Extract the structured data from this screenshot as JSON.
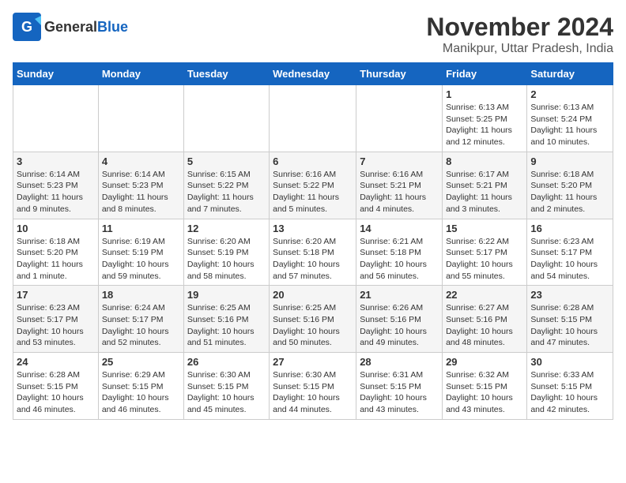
{
  "logo": {
    "general": "General",
    "blue": "Blue"
  },
  "title": "November 2024",
  "location": "Manikpur, Uttar Pradesh, India",
  "headers": [
    "Sunday",
    "Monday",
    "Tuesday",
    "Wednesday",
    "Thursday",
    "Friday",
    "Saturday"
  ],
  "rows": [
    [
      {
        "day": "",
        "info": ""
      },
      {
        "day": "",
        "info": ""
      },
      {
        "day": "",
        "info": ""
      },
      {
        "day": "",
        "info": ""
      },
      {
        "day": "",
        "info": ""
      },
      {
        "day": "1",
        "info": "Sunrise: 6:13 AM\nSunset: 5:25 PM\nDaylight: 11 hours and 12 minutes."
      },
      {
        "day": "2",
        "info": "Sunrise: 6:13 AM\nSunset: 5:24 PM\nDaylight: 11 hours and 10 minutes."
      }
    ],
    [
      {
        "day": "3",
        "info": "Sunrise: 6:14 AM\nSunset: 5:23 PM\nDaylight: 11 hours and 9 minutes."
      },
      {
        "day": "4",
        "info": "Sunrise: 6:14 AM\nSunset: 5:23 PM\nDaylight: 11 hours and 8 minutes."
      },
      {
        "day": "5",
        "info": "Sunrise: 6:15 AM\nSunset: 5:22 PM\nDaylight: 11 hours and 7 minutes."
      },
      {
        "day": "6",
        "info": "Sunrise: 6:16 AM\nSunset: 5:22 PM\nDaylight: 11 hours and 5 minutes."
      },
      {
        "day": "7",
        "info": "Sunrise: 6:16 AM\nSunset: 5:21 PM\nDaylight: 11 hours and 4 minutes."
      },
      {
        "day": "8",
        "info": "Sunrise: 6:17 AM\nSunset: 5:21 PM\nDaylight: 11 hours and 3 minutes."
      },
      {
        "day": "9",
        "info": "Sunrise: 6:18 AM\nSunset: 5:20 PM\nDaylight: 11 hours and 2 minutes."
      }
    ],
    [
      {
        "day": "10",
        "info": "Sunrise: 6:18 AM\nSunset: 5:20 PM\nDaylight: 11 hours and 1 minute."
      },
      {
        "day": "11",
        "info": "Sunrise: 6:19 AM\nSunset: 5:19 PM\nDaylight: 10 hours and 59 minutes."
      },
      {
        "day": "12",
        "info": "Sunrise: 6:20 AM\nSunset: 5:19 PM\nDaylight: 10 hours and 58 minutes."
      },
      {
        "day": "13",
        "info": "Sunrise: 6:20 AM\nSunset: 5:18 PM\nDaylight: 10 hours and 57 minutes."
      },
      {
        "day": "14",
        "info": "Sunrise: 6:21 AM\nSunset: 5:18 PM\nDaylight: 10 hours and 56 minutes."
      },
      {
        "day": "15",
        "info": "Sunrise: 6:22 AM\nSunset: 5:17 PM\nDaylight: 10 hours and 55 minutes."
      },
      {
        "day": "16",
        "info": "Sunrise: 6:23 AM\nSunset: 5:17 PM\nDaylight: 10 hours and 54 minutes."
      }
    ],
    [
      {
        "day": "17",
        "info": "Sunrise: 6:23 AM\nSunset: 5:17 PM\nDaylight: 10 hours and 53 minutes."
      },
      {
        "day": "18",
        "info": "Sunrise: 6:24 AM\nSunset: 5:17 PM\nDaylight: 10 hours and 52 minutes."
      },
      {
        "day": "19",
        "info": "Sunrise: 6:25 AM\nSunset: 5:16 PM\nDaylight: 10 hours and 51 minutes."
      },
      {
        "day": "20",
        "info": "Sunrise: 6:25 AM\nSunset: 5:16 PM\nDaylight: 10 hours and 50 minutes."
      },
      {
        "day": "21",
        "info": "Sunrise: 6:26 AM\nSunset: 5:16 PM\nDaylight: 10 hours and 49 minutes."
      },
      {
        "day": "22",
        "info": "Sunrise: 6:27 AM\nSunset: 5:16 PM\nDaylight: 10 hours and 48 minutes."
      },
      {
        "day": "23",
        "info": "Sunrise: 6:28 AM\nSunset: 5:15 PM\nDaylight: 10 hours and 47 minutes."
      }
    ],
    [
      {
        "day": "24",
        "info": "Sunrise: 6:28 AM\nSunset: 5:15 PM\nDaylight: 10 hours and 46 minutes."
      },
      {
        "day": "25",
        "info": "Sunrise: 6:29 AM\nSunset: 5:15 PM\nDaylight: 10 hours and 46 minutes."
      },
      {
        "day": "26",
        "info": "Sunrise: 6:30 AM\nSunset: 5:15 PM\nDaylight: 10 hours and 45 minutes."
      },
      {
        "day": "27",
        "info": "Sunrise: 6:30 AM\nSunset: 5:15 PM\nDaylight: 10 hours and 44 minutes."
      },
      {
        "day": "28",
        "info": "Sunrise: 6:31 AM\nSunset: 5:15 PM\nDaylight: 10 hours and 43 minutes."
      },
      {
        "day": "29",
        "info": "Sunrise: 6:32 AM\nSunset: 5:15 PM\nDaylight: 10 hours and 43 minutes."
      },
      {
        "day": "30",
        "info": "Sunrise: 6:33 AM\nSunset: 5:15 PM\nDaylight: 10 hours and 42 minutes."
      }
    ]
  ]
}
